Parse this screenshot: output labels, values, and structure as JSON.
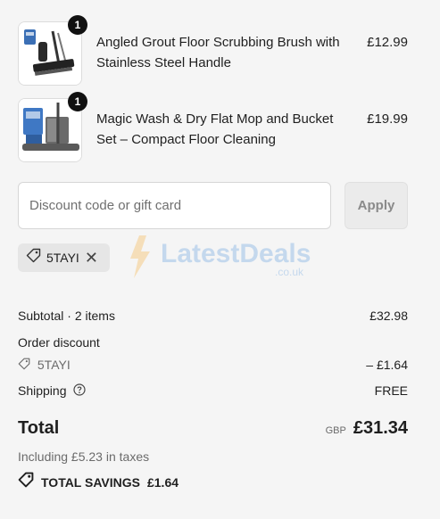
{
  "items": [
    {
      "quantity": "1",
      "title": "Angled Grout Floor Scrubbing Brush with Stainless Steel Handle",
      "price": "£12.99",
      "image_icon": "scrub-brush-product-image"
    },
    {
      "quantity": "1",
      "title": "Magic Wash & Dry Flat Mop and Bucket Set – Compact Floor Cleaning",
      "price": "£19.99",
      "image_icon": "mop-bucket-product-image"
    }
  ],
  "discount": {
    "placeholder": "Discount code or gift card",
    "value": "",
    "apply_label": "Apply",
    "applied_code": "5TAYI"
  },
  "watermark": {
    "brand": "LatestDeals",
    "suffix": ".co.uk"
  },
  "summary": {
    "subtotal_label": "Subtotal · 2 items",
    "subtotal_value": "£32.98",
    "order_discount_label": "Order discount",
    "discount_code": "5TAYI",
    "discount_value": "– £1.64",
    "shipping_label": "Shipping",
    "shipping_value": "FREE",
    "total_label": "Total",
    "currency": "GBP",
    "total_value": "£31.34",
    "tax_note": "Including £5.23 in taxes",
    "savings_label": "TOTAL SAVINGS",
    "savings_value": "£1.64"
  },
  "colors": {
    "background": "#f5f5f5",
    "badge": "#111111",
    "watermark_blue": "#4a90d9",
    "watermark_bolt": "#f5a623"
  }
}
